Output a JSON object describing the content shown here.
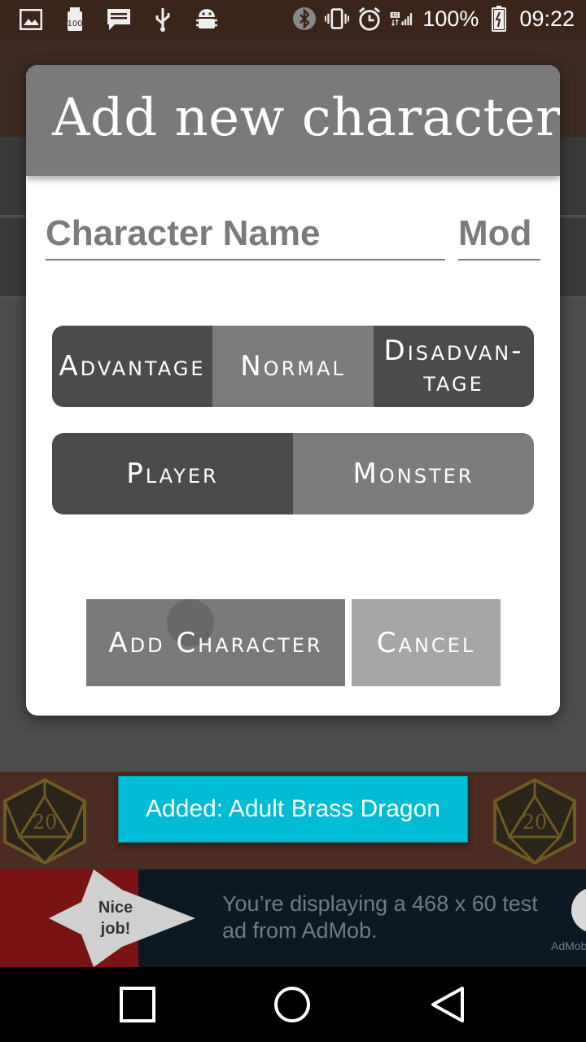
{
  "status_bar": {
    "battery": "100%",
    "time": "09:22",
    "network": "4G"
  },
  "dialog": {
    "title": "Add new character",
    "name_placeholder": "Character Name",
    "mod_placeholder": "Mod",
    "roll_mode": {
      "options": [
        "Advantage",
        "Normal",
        "Disadvan-\ntage"
      ],
      "selected": "Normal"
    },
    "character_type": {
      "options": [
        "Player",
        "Monster"
      ],
      "selected": "Monster"
    },
    "add_label": "Add Character",
    "cancel_label": "Cancel"
  },
  "toast": "Added: Adult Brass Dragon",
  "ad": {
    "star_text": "Nice job!",
    "message": "You’re displaying a 468 x 60 test ad from AdMob.",
    "brand": "AdMob"
  },
  "colors": {
    "dialog_header": "#7a7a7a",
    "segment_dark": "#4b4b4b",
    "segment_light": "#7c7c7c",
    "toast": "#00bcd4",
    "status_bar": "#3b2419"
  }
}
